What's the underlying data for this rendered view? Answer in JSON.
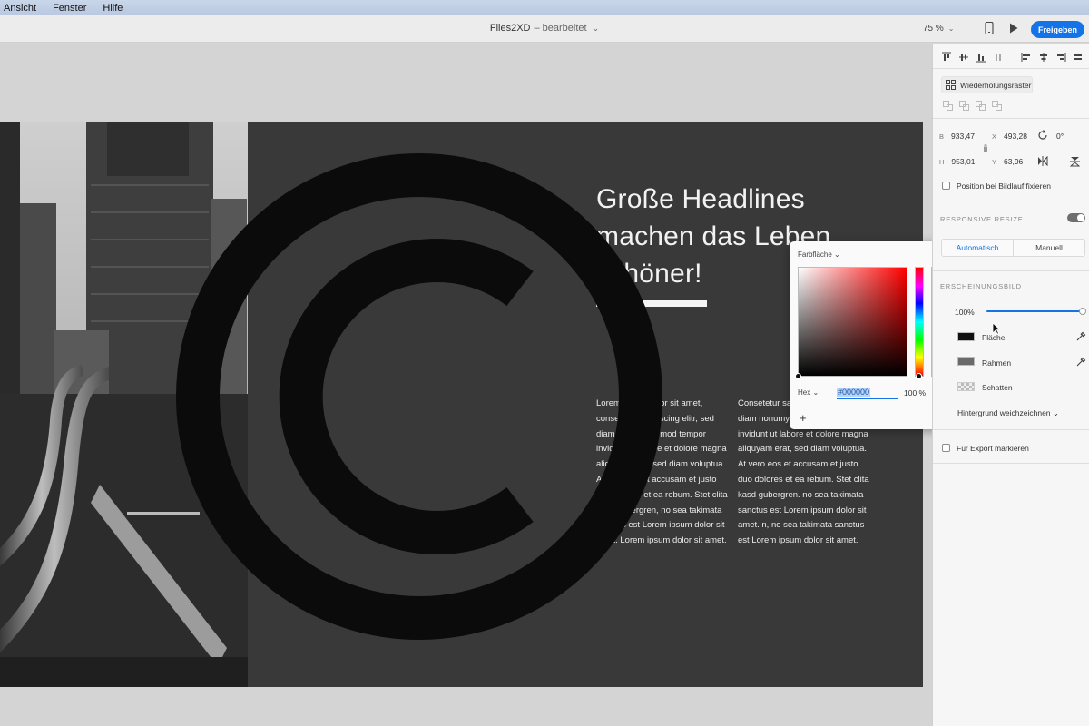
{
  "menubar": {
    "items": [
      "Ansicht",
      "Fenster",
      "Hilfe"
    ]
  },
  "titlebar": {
    "doc_name": "Files2XD",
    "doc_status": "– bearbeitet",
    "zoom": "75 %",
    "share_label": "Freigeben"
  },
  "artboard": {
    "headline": "Große Headlines machen das Leben schöner!",
    "col1": "Lorem ipsum dolor sit amet, consetetur sadipscing elitr, sed diam nonumy eirmod tempor invidunt ut labore et dolore magna aliquyam erat, sed diam voluptua. At vero eos et accusam et justo duo dolores et ea rebum. Stet clita kasd gubergren, no sea takimata sanctus est Lorem ipsum dolor sit amet. Lorem ipsum dolor sit amet.",
    "col2": "Consetetur sadipscing elitr, sed diam nonumy eirmod tempor invidunt ut labore et dolore magna aliquyam erat, sed diam voluptua. At vero eos et accusam et justo duo dolores et ea rebum. Stet clita kasd gubergren. no sea takimata sanctus est Lorem ipsum dolor sit amet. n, no sea takimata sanctus est Lorem ipsum dolor sit amet."
  },
  "panel": {
    "repeat_grid": "Wiederholungsraster",
    "props": {
      "w_key": "B",
      "w_val": "933,47",
      "h_key": "H",
      "h_val": "953,01",
      "x_key": "X",
      "x_val": "493,28",
      "y_key": "Y",
      "y_val": "63,96",
      "rotation": "0°"
    },
    "fix_position": "Position bei Bildlauf fixieren",
    "responsive_title": "RESPONSIVE RESIZE",
    "seg_auto": "Automatisch",
    "seg_manual": "Manuell",
    "appearance_title": "ERSCHEINUNGSBILD",
    "opacity": "100%",
    "fill_label": "Fläche",
    "border_label": "Rahmen",
    "shadow_label": "Schatten",
    "blur_label": "Hintergrund weichzeichnen",
    "export_label": "Für Export markieren",
    "fill_color": "#111111",
    "border_color": "#6a6a6a"
  },
  "picker": {
    "fill_type": "Farbfläche",
    "mode": "Hex",
    "hex_value": "#000000",
    "alpha": "100 %",
    "add": "+"
  },
  "colors": {
    "accent": "#1473e6",
    "artboard_bg": "#393939"
  }
}
